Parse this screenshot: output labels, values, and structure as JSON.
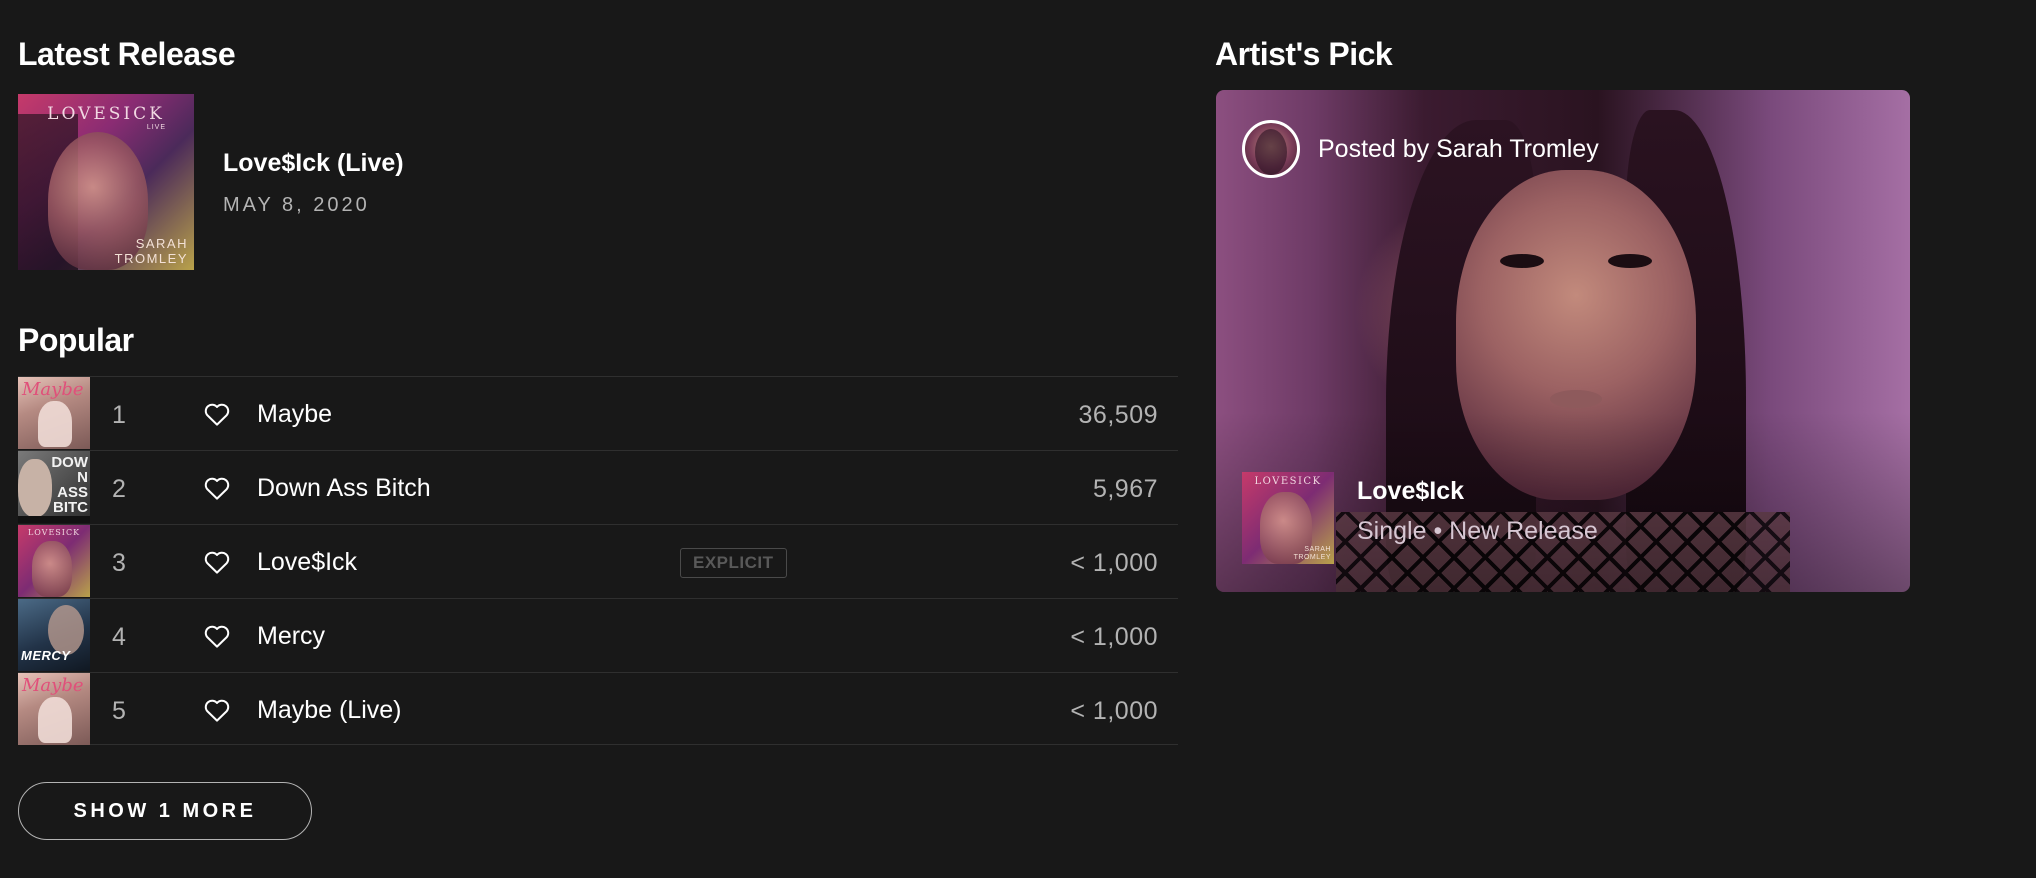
{
  "latest_release": {
    "heading": "Latest Release",
    "cover": {
      "title_text": "LOVESICK",
      "subtitle_text": "LIVE",
      "artist_line_1": "SARAH",
      "artist_line_2": "TROMLEY"
    },
    "name": "Love$Ick (Live)",
    "date": "MAY 8, 2020"
  },
  "popular": {
    "heading": "Popular",
    "tracks": [
      {
        "number": "1",
        "name": "Maybe",
        "plays": "36,509",
        "explicit": false,
        "thumb_text": "Maybe",
        "heart_icon": "heart-outline-icon"
      },
      {
        "number": "2",
        "name": "Down Ass Bitch",
        "plays": "5,967",
        "explicit": false,
        "thumb_text": "DOWN ASS BITCH",
        "heart_icon": "heart-outline-icon"
      },
      {
        "number": "3",
        "name": "Love$Ick",
        "plays": "< 1,000",
        "explicit": true,
        "explicit_label": "EXPLICIT",
        "thumb_text": "LOVESICK",
        "heart_icon": "heart-outline-icon"
      },
      {
        "number": "4",
        "name": "Mercy",
        "plays": "< 1,000",
        "explicit": false,
        "thumb_text": "MERCY",
        "heart_icon": "heart-outline-icon"
      },
      {
        "number": "5",
        "name": "Maybe (Live)",
        "plays": "< 1,000",
        "explicit": false,
        "thumb_text": "Maybe",
        "heart_icon": "heart-outline-icon"
      }
    ],
    "show_more_label": "SHOW 1 MORE"
  },
  "artists_pick": {
    "heading": "Artist's Pick",
    "posted_by": "Posted by Sarah Tromley",
    "release_title": "Love$Ick",
    "release_subtitle": "Single • New Release",
    "cover": {
      "title_text": "LOVESICK",
      "artist_line_1": "SARAH",
      "artist_line_2": "TROMLEY"
    }
  },
  "colors": {
    "background": "#181818",
    "text_primary": "#ffffff",
    "text_secondary": "#b3b3b3",
    "divider": "#2f2f2f"
  }
}
